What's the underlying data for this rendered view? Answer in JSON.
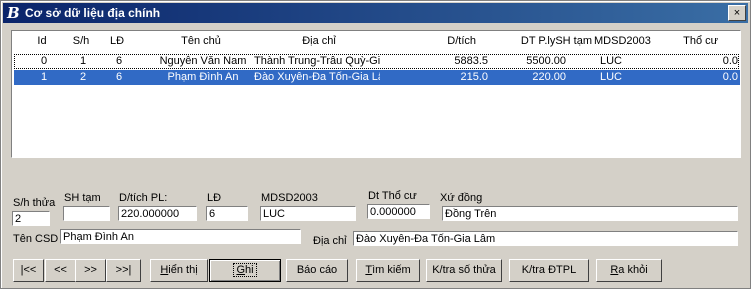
{
  "window": {
    "title": "Cơ sở dữ liệu địa chính",
    "logo": "B",
    "close": "×"
  },
  "grid": {
    "columns": [
      "Id",
      "S/h",
      "LĐ",
      "Tên chủ",
      "Địa chỉ",
      "D/tích",
      "DT P.lySH tạm",
      "MDSD2003",
      "Thổ cư"
    ],
    "rows": [
      {
        "id": "0",
        "sh": "1",
        "ld": "6",
        "chu": "Nguyễn Văn Nam",
        "diachi": "Thành Trung-Trâu Quỳ-Gia",
        "dt": "5883.5",
        "dtp": "5500.00",
        "md": "LUC",
        "tc": "0.0"
      },
      {
        "id": "1",
        "sh": "2",
        "ld": "6",
        "chu": "Phạm Đình An",
        "diachi": "Đào Xuyên-Đa Tốn-Gia Lâm",
        "dt": "215.0",
        "dtp": "220.00",
        "md": "LUC",
        "tc": "0.0"
      }
    ]
  },
  "form": {
    "sh_thua": {
      "label": "S/h thửa",
      "value": "2"
    },
    "sh_tam": {
      "label": "SH tạm",
      "value": ""
    },
    "dtich_pl": {
      "label": "D/tích PL:",
      "value": "220.000000"
    },
    "ld": {
      "label": "LĐ",
      "value": "6"
    },
    "mdsd": {
      "label": "MDSD2003",
      "value": "LUC"
    },
    "dt_thocu": {
      "label": "Dt Thổ cư",
      "value": "0.000000"
    },
    "xu_dong": {
      "label": "Xứ đồng",
      "value": "Đồng Trên"
    },
    "ten_csd": {
      "label": "Tên CSD",
      "value": "Phạm Đình An"
    },
    "dia_chi": {
      "label": "Địa chỉ",
      "value": "Đào Xuyên-Đa Tốn-Gia Lâm"
    }
  },
  "nav": {
    "first": "|<<",
    "prev": "<<",
    "next": ">>",
    "last": ">>|"
  },
  "actions": {
    "hien_thi": {
      "pre": "",
      "ul": "H",
      "post": "iển thị"
    },
    "ghi": {
      "pre": "",
      "ul": "G",
      "post": "hi"
    },
    "bao_cao": {
      "pre": "",
      "ul": "",
      "post": "Báo cáo"
    },
    "tim_kiem": {
      "pre": "",
      "ul": "T",
      "post": "ìm kiếm"
    },
    "ktra_so_thua": {
      "pre": "K/tra số thửa",
      "ul": "",
      "post": ""
    },
    "ktra_dtpl": {
      "pre": "K/tra ĐTPL",
      "ul": "",
      "post": ""
    },
    "ra_khoi": {
      "pre": "",
      "ul": "R",
      "post": "a khỏi"
    }
  }
}
